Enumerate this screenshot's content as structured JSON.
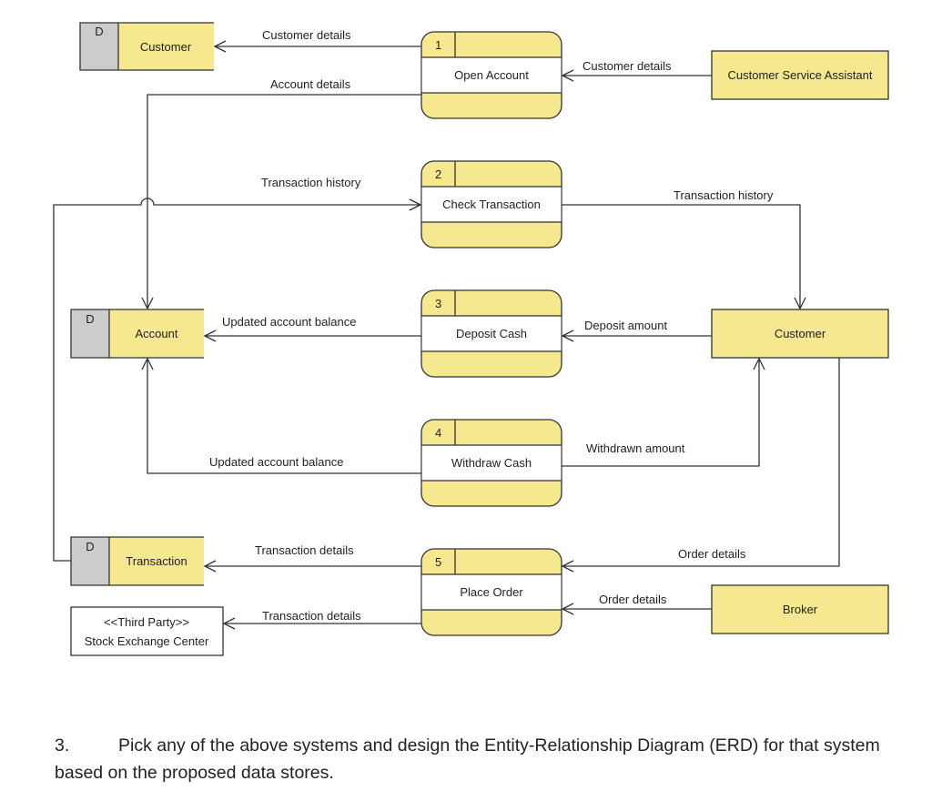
{
  "colors": {
    "process_fill": "#F5E88F",
    "store_tab": "#CCCCCC",
    "line": "#333333"
  },
  "data_stores": [
    {
      "tag": "D",
      "label": "Customer"
    },
    {
      "tag": "D",
      "label": "Account"
    },
    {
      "tag": "D",
      "label": "Transaction"
    }
  ],
  "processes": [
    {
      "number": "1",
      "label": "Open Account"
    },
    {
      "number": "2",
      "label": "Check Transaction"
    },
    {
      "number": "3",
      "label": "Deposit Cash"
    },
    {
      "number": "4",
      "label": "Withdraw Cash"
    },
    {
      "number": "5",
      "label": "Place Order"
    }
  ],
  "external_entities": [
    {
      "label": "Customer Service Assistant"
    },
    {
      "label": "Customer"
    },
    {
      "label": "Broker"
    },
    {
      "stereotype": "<<Third Party>>",
      "label": "Stock Exchange Center"
    }
  ],
  "flows": [
    {
      "label": "Customer details"
    },
    {
      "label": "Account details"
    },
    {
      "label": "Customer details"
    },
    {
      "label": "Transaction history"
    },
    {
      "label": "Transaction history"
    },
    {
      "label": "Updated account balance"
    },
    {
      "label": "Deposit amount"
    },
    {
      "label": "Updated account balance"
    },
    {
      "label": "Withdrawn amount"
    },
    {
      "label": "Transaction details"
    },
    {
      "label": "Order details"
    },
    {
      "label": "Order details"
    },
    {
      "label": "Transaction details"
    }
  ],
  "question": {
    "number": "3.",
    "text": "Pick any of the above systems and design the Entity-Relationship Diagram (ERD) for that system based on the proposed data stores."
  }
}
